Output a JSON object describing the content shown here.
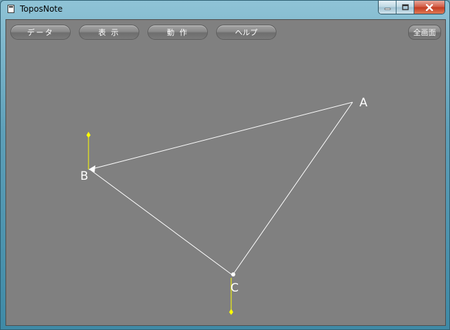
{
  "window": {
    "title": "ToposNote"
  },
  "menu": {
    "data": "データ",
    "view": "表 示",
    "action": "動 作",
    "help": "ヘルプ",
    "fullscreen": "全画面"
  },
  "canvas": {
    "points": [
      {
        "id": "A",
        "label": "A"
      },
      {
        "id": "B",
        "label": "B"
      },
      {
        "id": "C",
        "label": "C"
      }
    ],
    "colors": {
      "background": "#808080",
      "edges": "#ffffff",
      "handles": "#ffff00"
    }
  }
}
